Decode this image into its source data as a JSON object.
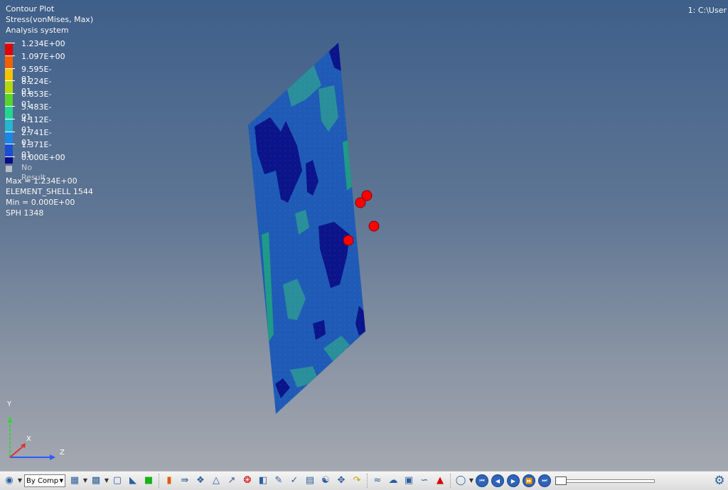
{
  "header": {
    "plot_type": "Contour Plot",
    "result_type": "Stress(vonMises, Max)",
    "coordinate_system": "Analysis system",
    "window_path": "1: C:\\User"
  },
  "legend": {
    "entries": [
      {
        "label": "1.234E+00",
        "color": "#e00000"
      },
      {
        "label": "1.097E+00",
        "color": "#f26100"
      },
      {
        "label": "9.595E-01",
        "color": "#f5c400"
      },
      {
        "label": "8.224E-01",
        "color": "#b9d80b"
      },
      {
        "label": "6.853E-01",
        "color": "#5ad42a"
      },
      {
        "label": "5.483E-01",
        "color": "#21d890"
      },
      {
        "label": "4.112E-01",
        "color": "#24b7cf"
      },
      {
        "label": "2.741E-01",
        "color": "#1c86e6"
      },
      {
        "label": "1.371E-01",
        "color": "#1a4fd2"
      },
      {
        "label": "0.000E+00",
        "color": "#0a0a8c"
      }
    ],
    "no_result_label": "No Result"
  },
  "stats": {
    "max_line": "Max =  1.234E+00",
    "max_entity": "ELEMENT_SHELL 1544",
    "min_line": "Min =  0.000E+00",
    "min_entity": "SPH 1348"
  },
  "triad": {
    "y": "Y",
    "x": "X",
    "z": "Z"
  },
  "toolbar": {
    "component_mode": "By Comp",
    "icons": [
      "shaded-mode-icon",
      "wireframe-icon",
      "element-display-icon",
      "isometric-icon",
      "mirror-icon",
      "component-color-icon",
      "contour-icon",
      "vector-icon",
      "tensor-icon",
      "deformed-icon",
      "measure-icon",
      "query-icon",
      "section-cut-icon",
      "note-icon",
      "clipping-icon",
      "table-icon",
      "tracking-icon",
      "translate-icon",
      "flip-icon",
      "iso-value-icon",
      "notes-balloon-icon",
      "box-icon",
      "streamlines-icon",
      "chart-icon"
    ],
    "colors": {
      "accent": "#2f63b8"
    }
  },
  "colors": {
    "background_top": "#3e5f8a",
    "background_bottom": "#a4a8b0",
    "marker": "#ff0000",
    "plate_base": "#1f5bb6"
  }
}
